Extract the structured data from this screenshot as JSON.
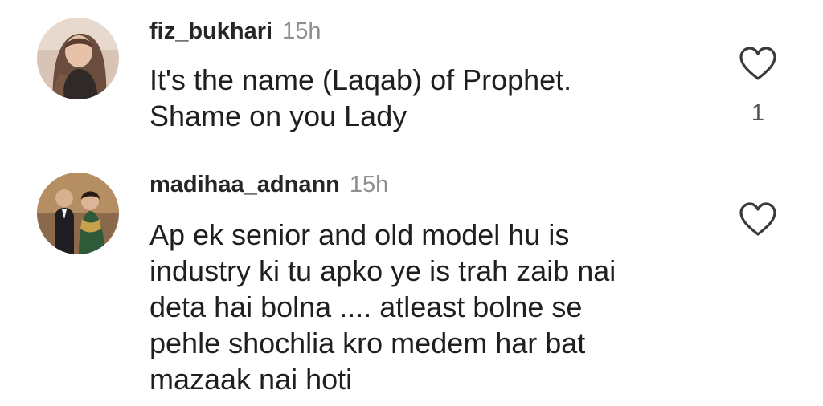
{
  "comments": [
    {
      "username": "fiz_bukhari",
      "time": "15h",
      "lines": [
        "It's the name (Laqab) of Prophet.",
        "Shame on you Lady"
      ],
      "like_count": "1",
      "avatar_icon": "avatar-woman-photo"
    },
    {
      "username": "madihaa_adnann",
      "time": "15h",
      "lines": [
        "Ap ek senior and old model hu is",
        "industry ki tu apko ye is trah zaib nai",
        "deta hai bolna .... atleast bolne se",
        "pehle shochlia kro medem har bat",
        "mazaak nai hoti"
      ],
      "like_count": "",
      "avatar_icon": "avatar-couple-photo"
    }
  ],
  "colors": {
    "username": "#262626",
    "time": "#8e8e8e",
    "text": "#1f1f1f",
    "icon_stroke": "#3a3a3a"
  }
}
